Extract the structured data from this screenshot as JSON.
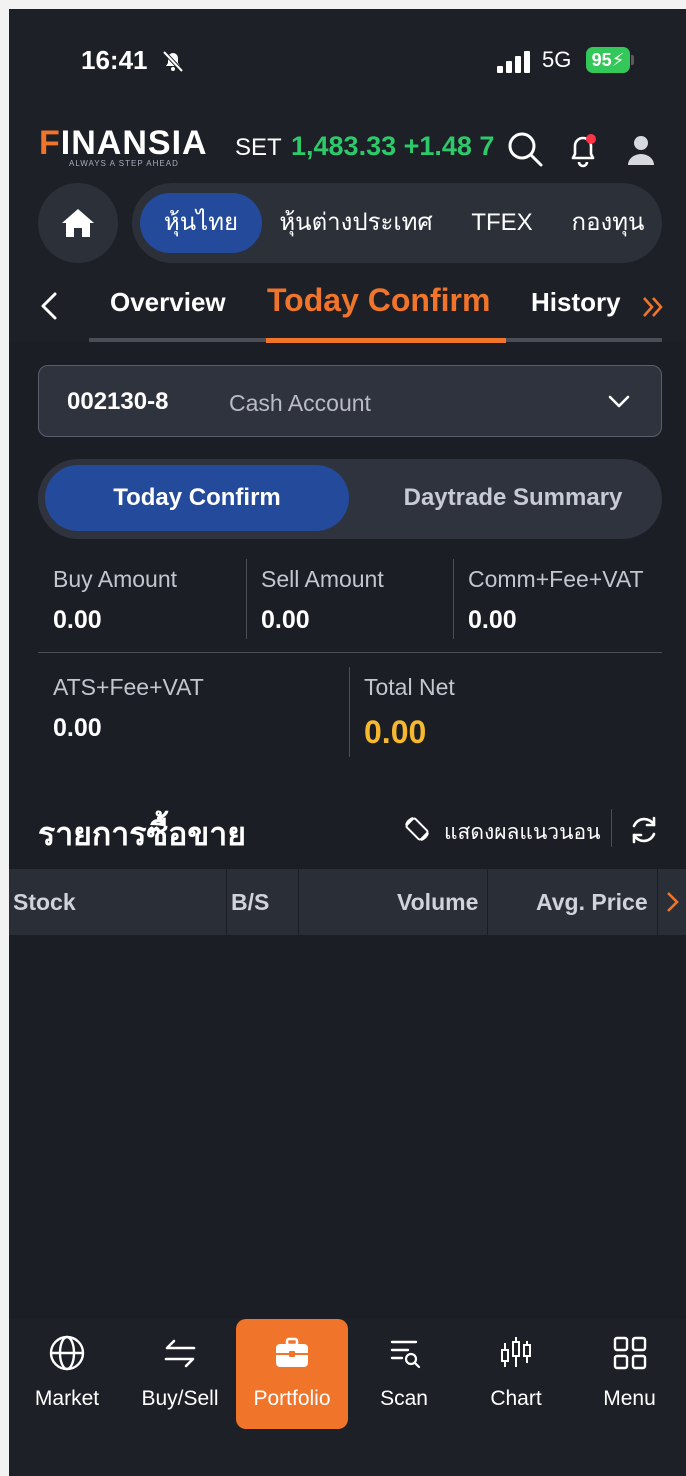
{
  "status_bar": {
    "time": "16:41",
    "network": "5G",
    "battery": "95"
  },
  "header": {
    "logo_f": "F",
    "logo_rest": "INANSIA",
    "logo_tagline": "ALWAYS A STEP AHEAD",
    "index_label": "SET",
    "index_value": "1,483.33 +1.48 7"
  },
  "market_tabs": [
    {
      "label": "หุ้นไทย",
      "active": true
    },
    {
      "label": "หุ้นต่างประเทศ",
      "active": false
    },
    {
      "label": "TFEX",
      "active": false
    },
    {
      "label": "กองทุน",
      "active": false
    }
  ],
  "sub_tabs": [
    {
      "label": "Overview",
      "active": false
    },
    {
      "label": "Today Confirm",
      "active": true
    },
    {
      "label": "History",
      "active": false
    }
  ],
  "account": {
    "number": "002130-8",
    "type": "Cash Account"
  },
  "segments": {
    "active": "Today Confirm",
    "inactive": "Daytrade Summary"
  },
  "summary": {
    "buy_label": "Buy Amount",
    "buy_value": "0.00",
    "sell_label": "Sell Amount",
    "sell_value": "0.00",
    "comm_label": "Comm+Fee+VAT",
    "comm_value": "0.00",
    "ats_label": "ATS+Fee+VAT",
    "ats_value": "0.00",
    "total_label": "Total Net",
    "total_value": "0.00"
  },
  "trades": {
    "title": "รายการซื้อขาย",
    "landscape_label": "แสดงผลแนวนอน",
    "columns": [
      "Stock",
      "B/S",
      "Volume",
      "Avg. Price"
    ],
    "rows": []
  },
  "bottom_nav": [
    {
      "label": "Market",
      "icon": "globe-icon",
      "active": false
    },
    {
      "label": "Buy/Sell",
      "icon": "swap-arrows-icon",
      "active": false
    },
    {
      "label": "Portfolio",
      "icon": "briefcase-icon",
      "active": true
    },
    {
      "label": "Scan",
      "icon": "scan-filter-icon",
      "active": false
    },
    {
      "label": "Chart",
      "icon": "candlestick-icon",
      "active": false
    },
    {
      "label": "Menu",
      "icon": "grid-menu-icon",
      "active": false
    }
  ],
  "colors": {
    "accent": "#f0742a",
    "active_blue": "#244a9c",
    "up_green": "#2dc96b",
    "total_yellow": "#f5b82e",
    "background": "#1b1e25"
  }
}
